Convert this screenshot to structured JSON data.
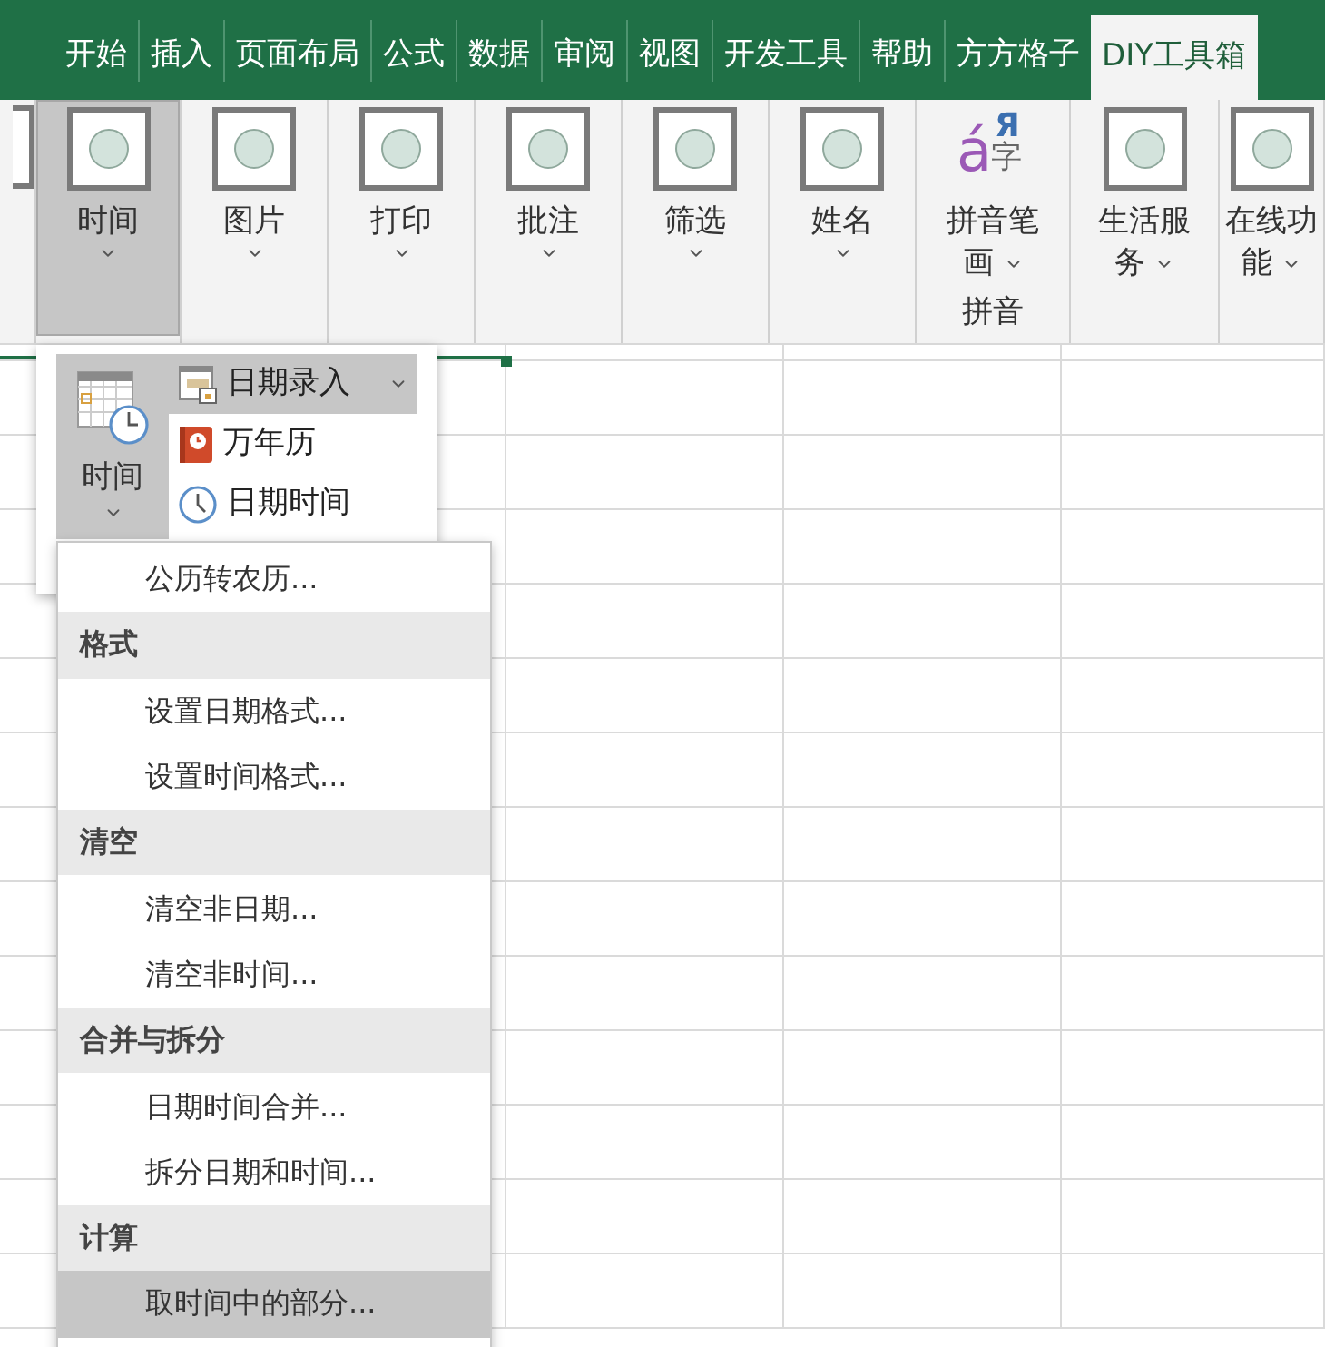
{
  "tabs": [
    {
      "label": "开始",
      "selected": false
    },
    {
      "label": "插入",
      "selected": false
    },
    {
      "label": "页面布局",
      "selected": false
    },
    {
      "label": "公式",
      "selected": false
    },
    {
      "label": "数据",
      "selected": false
    },
    {
      "label": "审阅",
      "selected": false
    },
    {
      "label": "视图",
      "selected": false
    },
    {
      "label": "开发工具",
      "selected": false
    },
    {
      "label": "帮助",
      "selected": false
    },
    {
      "label": "方方格子",
      "selected": false
    },
    {
      "label": "DIY工具箱",
      "selected": true
    }
  ],
  "ribbon": {
    "buttons": [
      {
        "kind": "partial"
      },
      {
        "kind": "placeholder",
        "label": "时间",
        "selected": true
      },
      {
        "kind": "placeholder",
        "label": "图片",
        "selected": false
      },
      {
        "kind": "placeholder",
        "label": "打印",
        "selected": false
      },
      {
        "kind": "placeholder",
        "label": "批注",
        "selected": false
      },
      {
        "kind": "placeholder",
        "label": "筛选",
        "selected": false
      },
      {
        "kind": "placeholder",
        "label": "姓名",
        "selected": false
      },
      {
        "kind": "pinyin",
        "label": "拼音笔画",
        "selected": false,
        "icon_glyphs": [
          "á",
          "Я",
          "字"
        ],
        "group_label": "拼音"
      },
      {
        "kind": "placeholder",
        "label": "生活服务",
        "selected": false
      },
      {
        "kind": "placeholder",
        "label": "在线功能",
        "selected": false
      }
    ]
  },
  "time_menu": {
    "button_label": "时间",
    "items": [
      {
        "kind": "entry",
        "label": "日期录入",
        "selected": true
      },
      {
        "kind": "calendar",
        "label": "万年历",
        "selected": false
      },
      {
        "kind": "clock",
        "label": "日期时间",
        "selected": false
      }
    ]
  },
  "submenu": {
    "items": [
      {
        "kind": "item",
        "label": "公历转农历...",
        "selected": false
      },
      {
        "kind": "header",
        "label": "格式",
        "selected": false
      },
      {
        "kind": "item",
        "label": "设置日期格式...",
        "selected": false
      },
      {
        "kind": "item",
        "label": "设置时间格式...",
        "selected": false
      },
      {
        "kind": "header",
        "label": "清空",
        "selected": false
      },
      {
        "kind": "item",
        "label": "清空非日期...",
        "selected": false
      },
      {
        "kind": "item",
        "label": "清空非时间...",
        "selected": false
      },
      {
        "kind": "header",
        "label": "合并与拆分",
        "selected": false
      },
      {
        "kind": "item",
        "label": "日期时间合并...",
        "selected": false
      },
      {
        "kind": "item",
        "label": "拆分日期和时间...",
        "selected": false
      },
      {
        "kind": "header",
        "label": "计算",
        "selected": false
      },
      {
        "kind": "item",
        "label": "取时间中的部分...",
        "selected": true
      }
    ]
  }
}
